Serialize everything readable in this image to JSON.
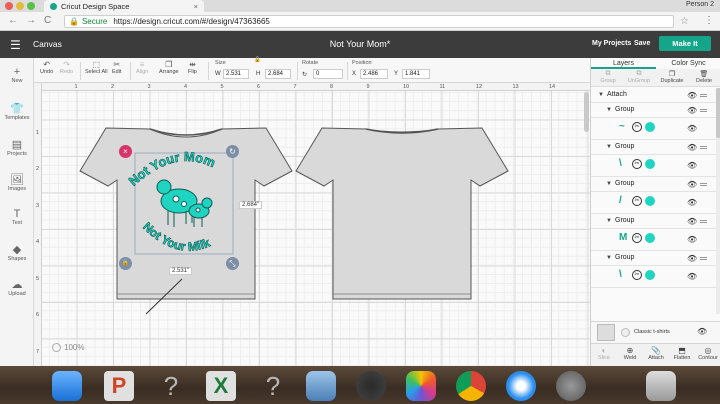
{
  "browser": {
    "tab_title": "Cricut Design Space",
    "tab_close": "×",
    "person": "Person 2",
    "back": "←",
    "forward": "→",
    "reload": "C",
    "secure_label": "Secure",
    "url": "https://design.cricut.com/#/design/47363665",
    "star": "☆",
    "menu": "⋮"
  },
  "app": {
    "menu_icon": "☰",
    "mode_label": "Canvas",
    "doc_title": "Not Your Mom*",
    "my_projects": "My Projects",
    "save": "Save",
    "make_it": "Make It"
  },
  "left_sidebar": [
    {
      "icon": "+",
      "icon_name": "new-icon",
      "label": "New"
    },
    {
      "icon": "👕",
      "icon_name": "templates-icon",
      "label": "Templates"
    },
    {
      "icon": "▤",
      "icon_name": "projects-icon",
      "label": "Projects"
    },
    {
      "icon": "🖼",
      "icon_name": "images-icon",
      "label": "Images"
    },
    {
      "icon": "T",
      "icon_name": "text-icon",
      "label": "Text"
    },
    {
      "icon": "◆",
      "icon_name": "shapes-icon",
      "label": "Shapes"
    },
    {
      "icon": "☁",
      "icon_name": "upload-icon",
      "label": "Upload"
    }
  ],
  "toolbar": {
    "undo": "Undo",
    "redo": "Redo",
    "select_all": "Select All",
    "edit": "Edit",
    "align": "Align",
    "arrange": "Arrange",
    "flip": "Flip",
    "size_label": "Size",
    "w_label": "W",
    "w_value": "2.531",
    "h_label": "H",
    "h_value": "2.684",
    "rotate_label": "Rotate",
    "rotate_value": "0",
    "position_label": "Position",
    "x_label": "X",
    "x_value": "2.486",
    "y_label": "Y",
    "y_value": "1.841"
  },
  "canvas": {
    "ruler_top": [
      "1",
      "2",
      "3",
      "4",
      "5",
      "6",
      "7",
      "8",
      "9",
      "10",
      "11",
      "12",
      "13",
      "14"
    ],
    "ruler_left": [
      "1",
      "2",
      "3",
      "4",
      "5",
      "6",
      "7"
    ],
    "zoom": "100%",
    "height_label": "2.684\"",
    "width_label": "2.531\"",
    "design_text_top": "Not Your Mom",
    "design_text_bottom": "Not Your Milk",
    "delete_icon": "×",
    "rotate_icon": "↻",
    "lock_icon": "🔒",
    "resize_icon": "⤡"
  },
  "layers_panel": {
    "tab_layers": "Layers",
    "tab_color_sync": "Color Sync",
    "top_actions": [
      "Group",
      "UnGroup",
      "Duplicate",
      "Delete"
    ],
    "attach_label": "Attach",
    "group_label": "Group",
    "cut_glyph": "✂",
    "thumb_glyphs": [
      "~",
      "\\",
      "/",
      "M",
      "\\"
    ],
    "blank_canvas_label": "Classic t-shirts",
    "bottom_actions": [
      "Slice",
      "Weld",
      "Attach",
      "Flatten",
      "Contour"
    ]
  },
  "colors": {
    "accent": "#15a58a",
    "design": "#20d4c2",
    "header": "#3c3c3c",
    "handle_delete": "#d8336a",
    "handle_other": "#7b8fa6",
    "shirt": "#d9d9d9"
  }
}
